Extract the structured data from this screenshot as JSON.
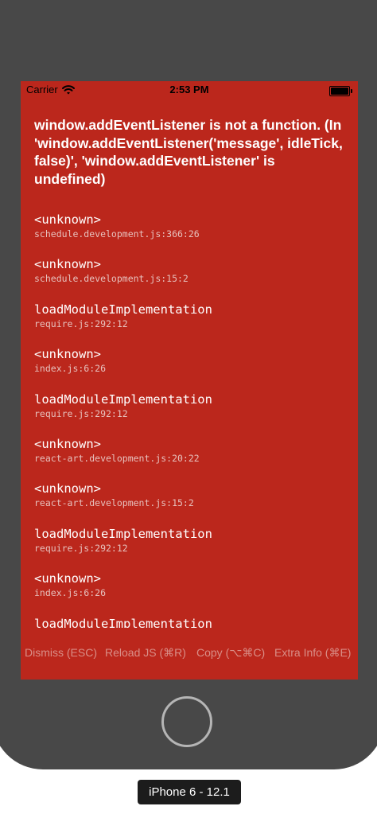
{
  "status_bar": {
    "carrier": "Carrier",
    "wifi_icon": "wifi-icon",
    "time": "2:53 PM",
    "battery_icon": "battery-icon"
  },
  "error": {
    "message": "window.addEventListener is not a function. (In 'window.addEventListener('message', idleTick, false)', 'window.addEventListener' is undefined)"
  },
  "stack_frames": [
    {
      "method": "<unknown>",
      "file": "schedule.development.js:366:26"
    },
    {
      "method": "<unknown>",
      "file": "schedule.development.js:15:2"
    },
    {
      "method": "loadModuleImplementation",
      "file": "require.js:292:12"
    },
    {
      "method": "<unknown>",
      "file": "index.js:6:26"
    },
    {
      "method": "loadModuleImplementation",
      "file": "require.js:292:12"
    },
    {
      "method": "<unknown>",
      "file": "react-art.development.js:20:22"
    },
    {
      "method": "<unknown>",
      "file": "react-art.development.js:15:2"
    },
    {
      "method": "loadModuleImplementation",
      "file": "require.js:292:12"
    },
    {
      "method": "<unknown>",
      "file": "index.js:6:26"
    },
    {
      "method": "loadModuleImplementation",
      "file": ""
    }
  ],
  "footer": {
    "dismiss": "Dismiss (ESC)",
    "reload": "Reload JS (⌘R)",
    "copy": "Copy (⌥⌘C)",
    "extra_info": "Extra Info (⌘E)"
  },
  "device_label": "iPhone 6 - 12.1",
  "colors": {
    "error_background": "#bb271c",
    "device_frame": "#484848",
    "footer_text": "#d98e87"
  }
}
